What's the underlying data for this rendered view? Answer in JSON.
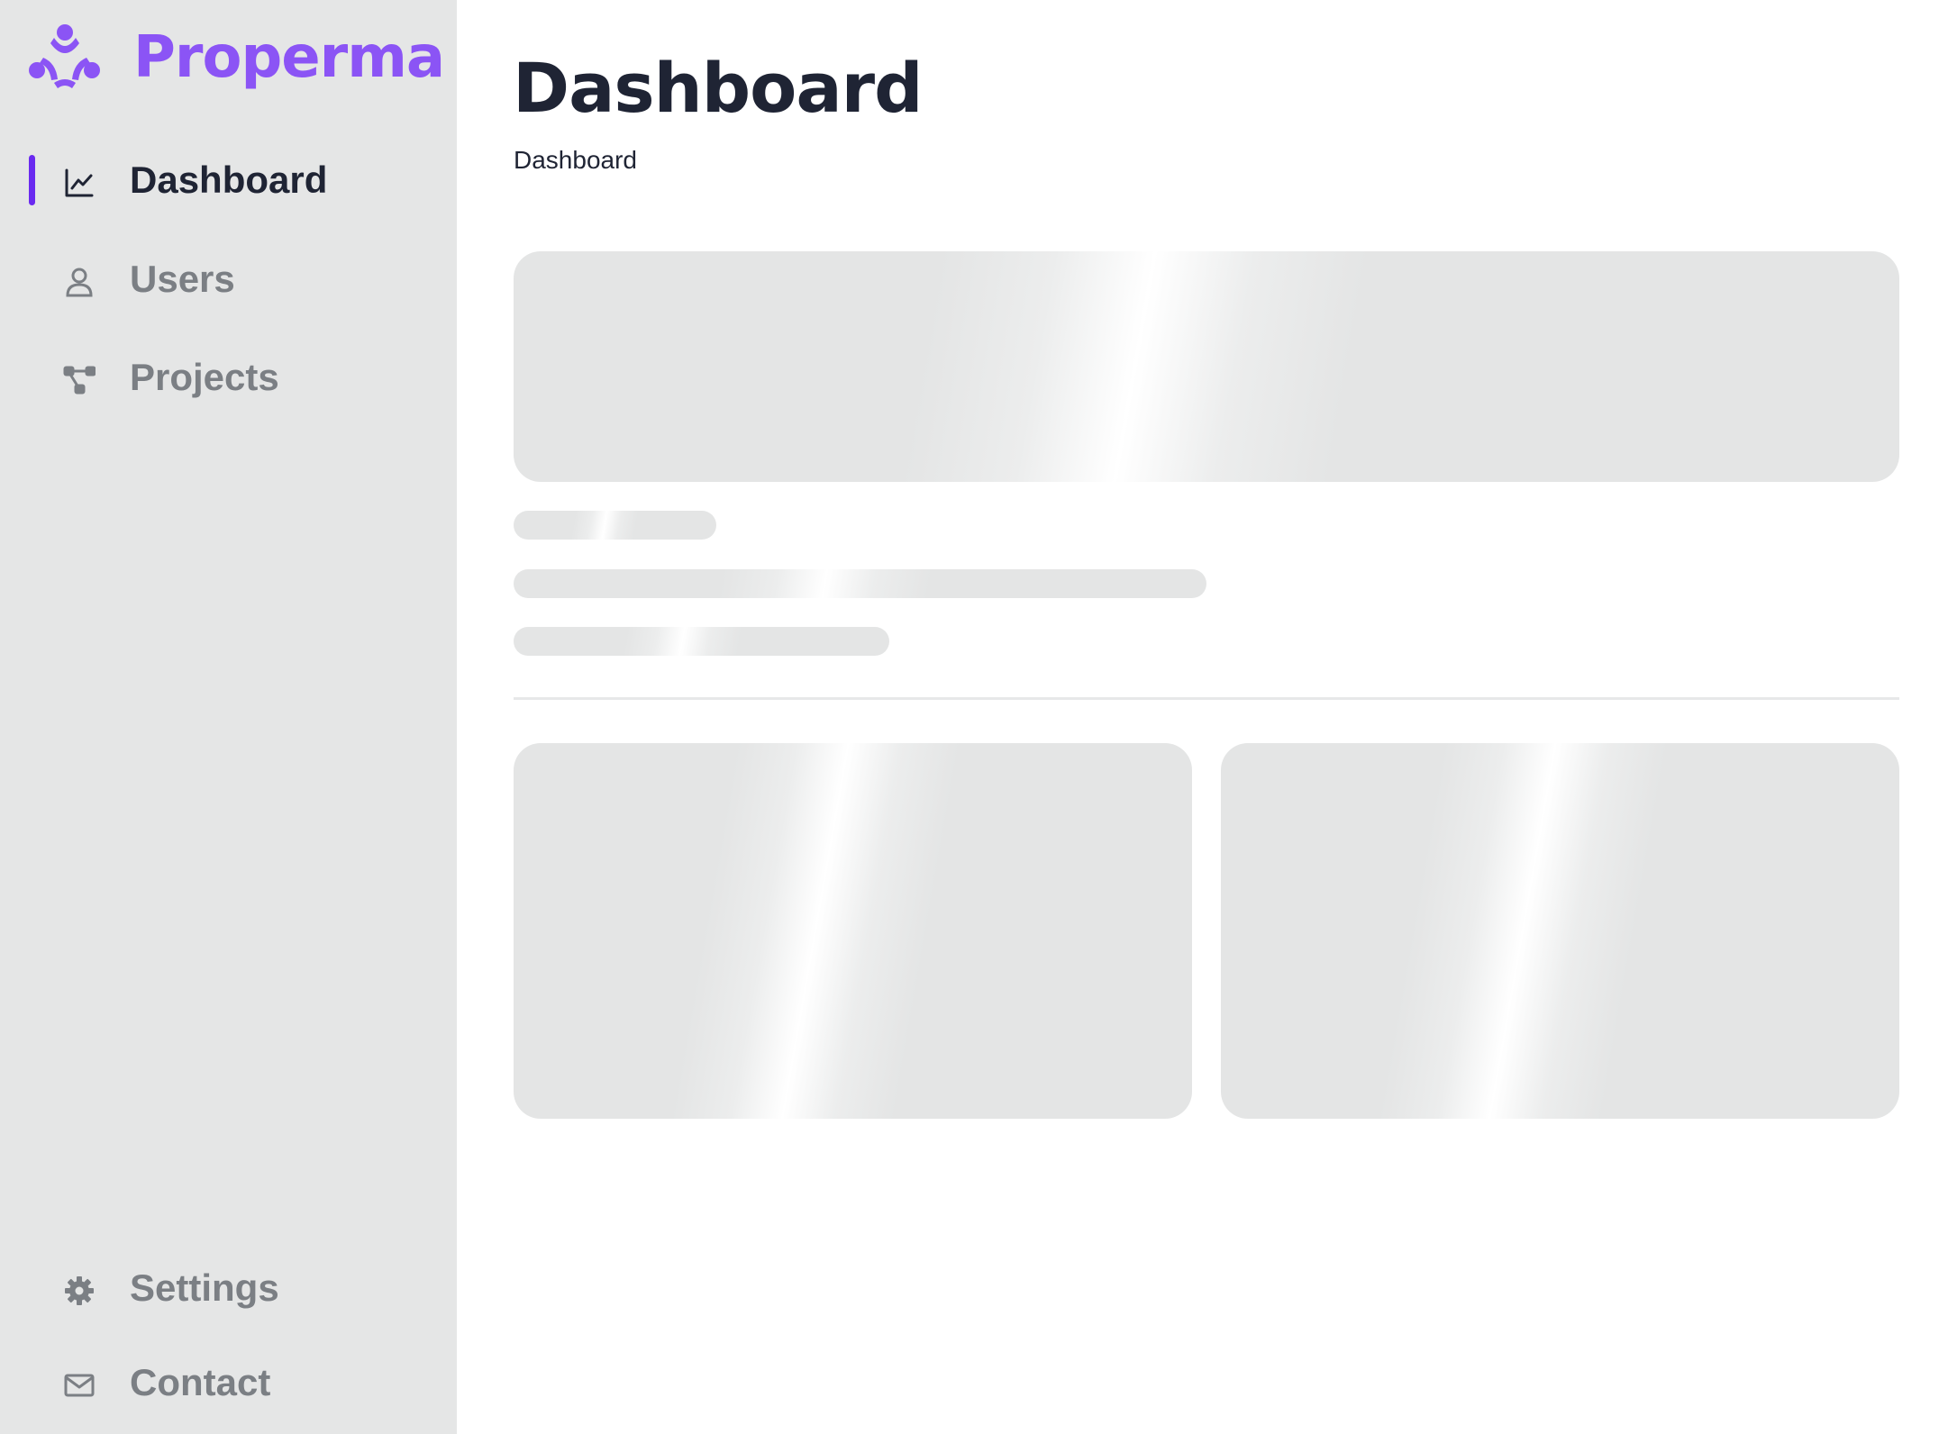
{
  "brand": {
    "name": "Properma",
    "logo_icon": "people-circle-logo-icon",
    "color": "#8b54f5"
  },
  "sidebar": {
    "accent": "#6a2af0",
    "items": [
      {
        "label": "Dashboard",
        "icon": "line-chart-icon",
        "active": true
      },
      {
        "label": "Users",
        "icon": "user-icon",
        "active": false
      },
      {
        "label": "Projects",
        "icon": "project-nodes-icon",
        "active": false
      }
    ],
    "bottom_items": [
      {
        "label": "Settings",
        "icon": "gear-icon"
      },
      {
        "label": "Contact",
        "icon": "envelope-icon"
      }
    ]
  },
  "main": {
    "title": "Dashboard",
    "breadcrumb": "Dashboard",
    "loading": true
  }
}
